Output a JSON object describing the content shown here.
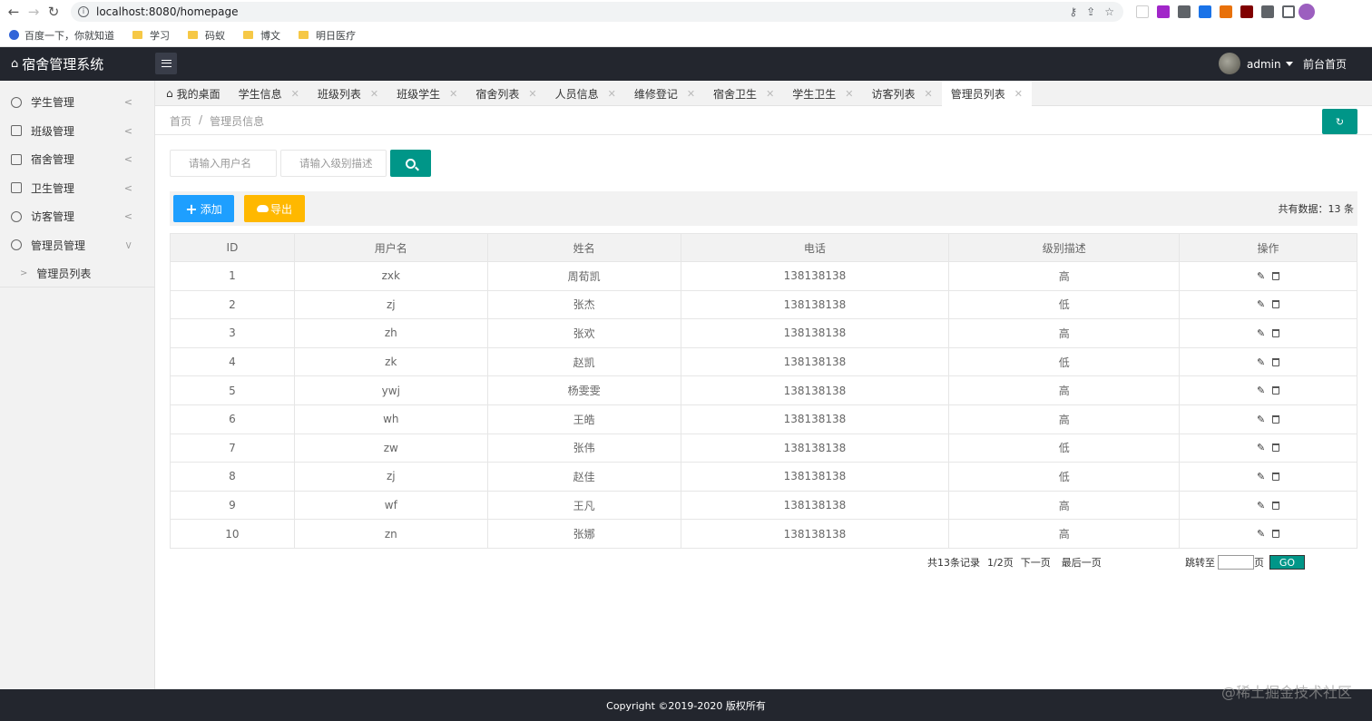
{
  "browser": {
    "url": "localhost:8080/homepage",
    "bookmarks": [
      "百度一下，你就知道",
      "学习",
      "码蚁",
      "博文",
      "明日医疗"
    ]
  },
  "header": {
    "logo": "宿舍管理系统",
    "user": "admin",
    "front_link": "前台首页"
  },
  "sidebar": {
    "items": [
      {
        "label": "学生管理"
      },
      {
        "label": "班级管理"
      },
      {
        "label": "宿舍管理"
      },
      {
        "label": "卫生管理"
      },
      {
        "label": "访客管理"
      },
      {
        "label": "管理员管理"
      }
    ],
    "sub_items": [
      {
        "label": "管理员列表"
      }
    ]
  },
  "tabs": [
    {
      "label": "我的桌面"
    },
    {
      "label": "学生信息"
    },
    {
      "label": "班级列表"
    },
    {
      "label": "班级学生"
    },
    {
      "label": "宿舍列表"
    },
    {
      "label": "人员信息"
    },
    {
      "label": "维修登记"
    },
    {
      "label": "宿舍卫生"
    },
    {
      "label": "学生卫生"
    },
    {
      "label": "访客列表"
    },
    {
      "label": "管理员列表"
    }
  ],
  "breadcrumb": {
    "home": "首页",
    "sep": "/",
    "current": "管理员信息"
  },
  "search": {
    "username_placeholder": "请输入用户名",
    "level_placeholder": "请输入级别描述"
  },
  "toolbar": {
    "add_label": "添加",
    "export_label": "导出",
    "total_label": "共有数据：13 条"
  },
  "table": {
    "headers": [
      "ID",
      "用户名",
      "姓名",
      "电话",
      "级别描述",
      "操作"
    ],
    "rows": [
      [
        "1",
        "zxk",
        "周荀凯",
        "138138138",
        "高"
      ],
      [
        "2",
        "zj",
        "张杰",
        "138138138",
        "低"
      ],
      [
        "3",
        "zh",
        "张欢",
        "138138138",
        "高"
      ],
      [
        "4",
        "zk",
        "赵凯",
        "138138138",
        "低"
      ],
      [
        "5",
        "ywj",
        "杨雯雯",
        "138138138",
        "高"
      ],
      [
        "6",
        "wh",
        "王皓",
        "138138138",
        "高"
      ],
      [
        "7",
        "zw",
        "张伟",
        "138138138",
        "低"
      ],
      [
        "8",
        "zj",
        "赵佳",
        "138138138",
        "低"
      ],
      [
        "9",
        "wf",
        "王凡",
        "138138138",
        "高"
      ],
      [
        "10",
        "zn",
        "张娜",
        "138138138",
        "高"
      ]
    ]
  },
  "pagination": {
    "records": "共13条记录",
    "page": "1/2页",
    "next": "下一页",
    "last": "最后一页",
    "jump_label": "跳转至",
    "page_unit": "页",
    "go": "GO"
  },
  "footer": {
    "copyright": "Copyright ©2019-2020 版权所有"
  },
  "watermark": "@稀土掘金技术社区",
  "colors": {
    "header_bg": "#23262e",
    "teal": "#009688",
    "blue": "#1e9fff",
    "orange": "#ffb800"
  }
}
